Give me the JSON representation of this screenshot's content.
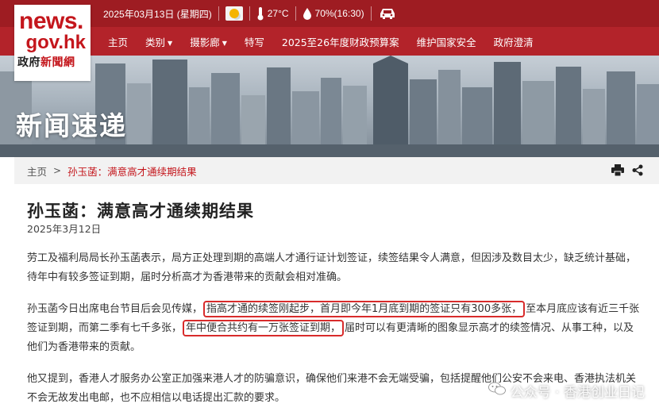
{
  "logo": {
    "main": "news.",
    "sub": "gov.hk",
    "cn_prefix": "政府",
    "cn_highlight": "新聞網"
  },
  "header": {
    "date": "2025年03月13日 (星期四)",
    "temperature": "27°C",
    "humidity": "70%(16:30)",
    "icons": [
      "weather-sunny-icon",
      "thermometer-icon",
      "humidity-drop-icon",
      "traffic-car-icon"
    ]
  },
  "nav": {
    "items": [
      {
        "label": "主页"
      },
      {
        "label": "类别",
        "caret": "▼"
      },
      {
        "label": "摄影廊",
        "caret": "▼"
      },
      {
        "label": "特写"
      },
      {
        "label": "2025至26年度财政预算案"
      },
      {
        "label": "维护国家安全"
      },
      {
        "label": "政府澄清"
      }
    ]
  },
  "hero": {
    "title": "新闻速递"
  },
  "breadcrumb": {
    "home": "主页",
    "arrow": ">",
    "current": "孙玉菡：满意高才通续期结果"
  },
  "tools": {
    "icons": [
      "print-icon",
      "share-icon"
    ]
  },
  "article": {
    "title": "孙玉菡：满意高才通续期结果",
    "date": "2025年3月12日",
    "p1": "劳工及福利局局长孙玉菡表示，局方正处理到期的高端人才通行证计划签证，续签结果令人满意，但因涉及数目太少，缺乏统计基础，待年中有较多签证到期，届时分析高才为香港带来的贡献会相对准确。",
    "p2_a": "孙玉菡今日出席电台节目后会见传媒，",
    "p2_hl1": "指高才通的续签刚起步，首月即今年1月底到期的签证只有300多张，",
    "p2_b": "至本月底应该有近三千张签证到期，而第二季有七千多张，",
    "p2_hl2": "年中便合共约有一万张签证到期，",
    "p2_c": "届时可以有更清晰的图象显示高才的续签情况、从事工种，以及他们为香港带来的贡献。",
    "p3": "他又提到，香港人才服务办公室正加强来港人才的防骗意识，确保他们来港不会无端受骗，包括提醒他们公安不会来电、香港执法机关不会无故发出电邮，也不应相信以电话提出汇款的要求。"
  },
  "watermark": {
    "text": "公众号 · 香港创业日记",
    "icon": "wechat-icon"
  },
  "colors": {
    "brand_red": "#b3232a",
    "highlight_border": "#d82b2b",
    "crumb_red": "#c4161c"
  }
}
